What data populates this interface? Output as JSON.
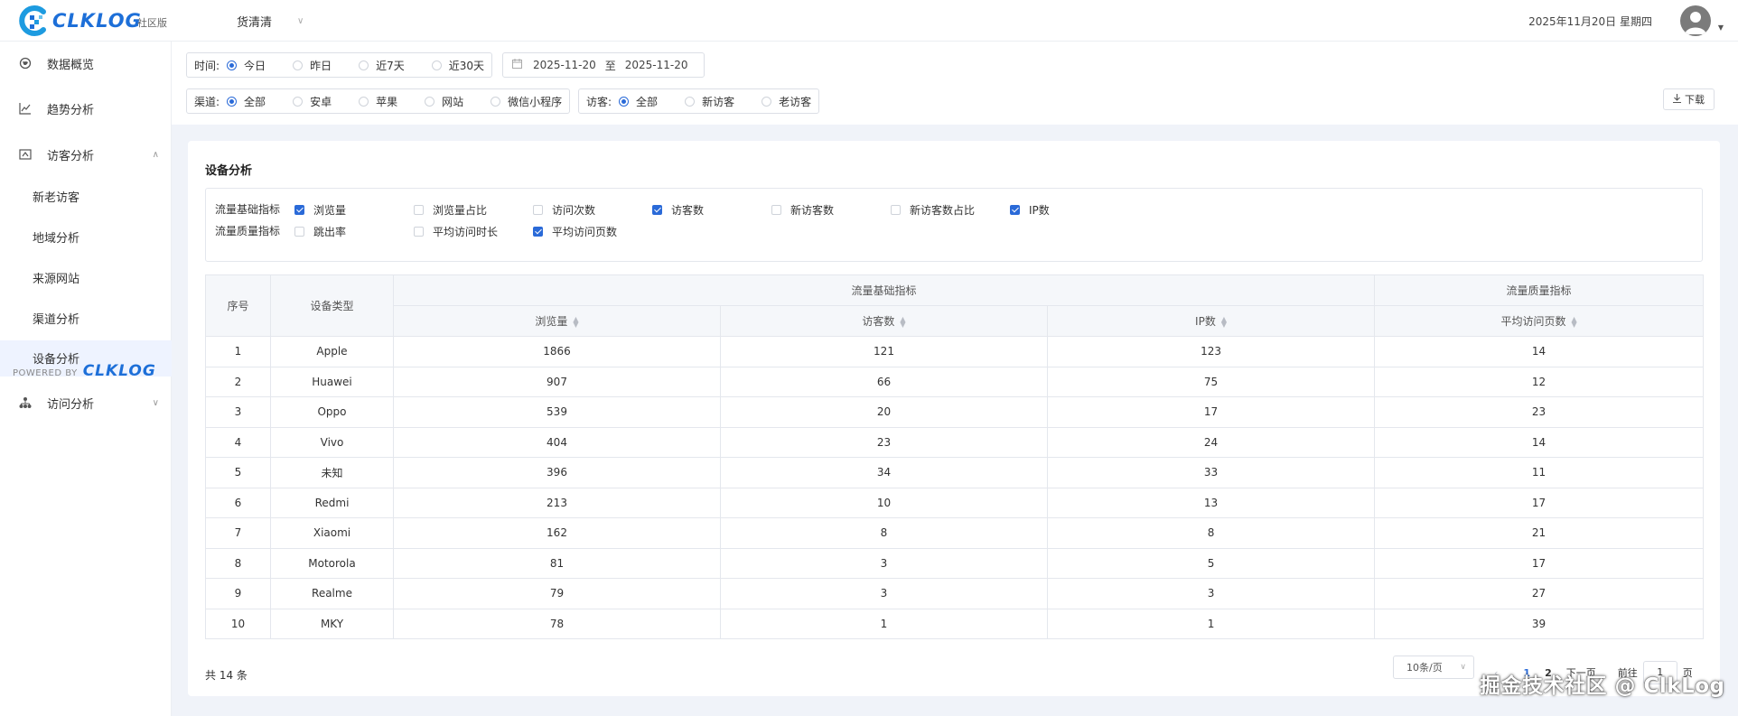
{
  "header": {
    "logo_text": "CLKLOG",
    "edition": "社区版",
    "project": "货清清",
    "date": "2025年11月20日 星期四"
  },
  "sidebar": {
    "items": [
      {
        "label": "数据概览",
        "icon": "globe-icon"
      },
      {
        "label": "趋势分析",
        "icon": "line-chart-icon"
      },
      {
        "label": "访客分析",
        "icon": "visitor-icon"
      },
      {
        "label": "访问分析",
        "icon": "org-icon"
      }
    ],
    "sub_items": [
      {
        "label": "新老访客"
      },
      {
        "label": "地域分析"
      },
      {
        "label": "来源网站"
      },
      {
        "label": "渠道分析"
      },
      {
        "label": "设备分析"
      }
    ],
    "powered_by": "POWERED BY",
    "powered_logo": "CLKLOG"
  },
  "filters": {
    "time_label": "时间:",
    "time_options": [
      "今日",
      "昨日",
      "近7天",
      "近30天"
    ],
    "date_start": "2025-11-20",
    "date_sep": "至",
    "date_end": "2025-11-20",
    "channel_label": "渠道:",
    "channel_options": [
      "全部",
      "安卓",
      "苹果",
      "网站",
      "微信小程序"
    ],
    "visitor_label": "访客:",
    "visitor_options": [
      "全部",
      "新访客",
      "老访客"
    ],
    "download": "下载"
  },
  "card": {
    "title": "设备分析",
    "metric_row1_label": "流量基础指标",
    "metric_row2_label": "流量质量指标",
    "metrics_row1": [
      {
        "label": "浏览量",
        "checked": true
      },
      {
        "label": "浏览量占比",
        "checked": false
      },
      {
        "label": "访问次数",
        "checked": false
      },
      {
        "label": "访客数",
        "checked": true
      },
      {
        "label": "新访客数",
        "checked": false
      },
      {
        "label": "新访客数占比",
        "checked": false
      },
      {
        "label": "IP数",
        "checked": true
      }
    ],
    "metrics_row2": [
      {
        "label": "跳出率",
        "checked": false
      },
      {
        "label": "平均访问时长",
        "checked": false
      },
      {
        "label": "平均访问页数",
        "checked": true
      }
    ]
  },
  "table": {
    "col_index": "序号",
    "col_device": "设备类型",
    "group_basic": "流量基础指标",
    "group_quality": "流量质量指标",
    "col_pv": "浏览量",
    "col_uv": "访客数",
    "col_ip": "IP数",
    "col_avg_pages": "平均访问页数",
    "rows": [
      {
        "idx": "1",
        "device": "Apple",
        "pv": "1866",
        "uv": "121",
        "ip": "123",
        "avg": "14"
      },
      {
        "idx": "2",
        "device": "Huawei",
        "pv": "907",
        "uv": "66",
        "ip": "75",
        "avg": "12"
      },
      {
        "idx": "3",
        "device": "Oppo",
        "pv": "539",
        "uv": "20",
        "ip": "17",
        "avg": "23"
      },
      {
        "idx": "4",
        "device": "Vivo",
        "pv": "404",
        "uv": "23",
        "ip": "24",
        "avg": "14"
      },
      {
        "idx": "5",
        "device": "未知",
        "pv": "396",
        "uv": "34",
        "ip": "33",
        "avg": "11"
      },
      {
        "idx": "6",
        "device": "Redmi",
        "pv": "213",
        "uv": "10",
        "ip": "13",
        "avg": "17"
      },
      {
        "idx": "7",
        "device": "Xiaomi",
        "pv": "162",
        "uv": "8",
        "ip": "8",
        "avg": "21"
      },
      {
        "idx": "8",
        "device": "Motorola",
        "pv": "81",
        "uv": "3",
        "ip": "5",
        "avg": "17"
      },
      {
        "idx": "9",
        "device": "Realme",
        "pv": "79",
        "uv": "3",
        "ip": "3",
        "avg": "27"
      },
      {
        "idx": "10",
        "device": "MKY",
        "pv": "78",
        "uv": "1",
        "ip": "1",
        "avg": "39"
      }
    ]
  },
  "pagination": {
    "total": "共 14 条",
    "page_size": "10条/页",
    "prev": "‹",
    "pages": [
      "1",
      "2"
    ],
    "next": "下一页",
    "goto": "前往",
    "current": "1",
    "page_unit": "页"
  },
  "watermark": "掘金技术社区 @ ClkLog"
}
